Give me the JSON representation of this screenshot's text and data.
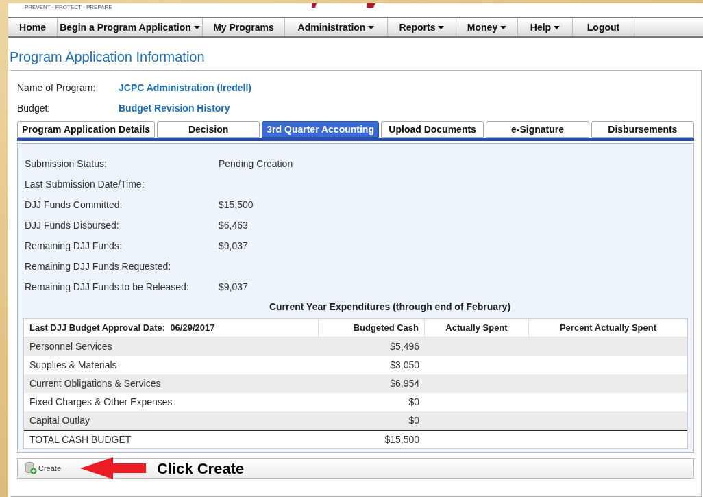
{
  "header": {
    "tagline": "PREVENT · PROTECT · PREPARE"
  },
  "nav": [
    {
      "label": "Home",
      "dropdown": false
    },
    {
      "label": "Begin a Program Application",
      "dropdown": true
    },
    {
      "label": "My Programs",
      "dropdown": false
    },
    {
      "label": "Administration",
      "dropdown": true
    },
    {
      "label": "Reports",
      "dropdown": true
    },
    {
      "label": "Money",
      "dropdown": true
    },
    {
      "label": "Help",
      "dropdown": true
    },
    {
      "label": "Logout",
      "dropdown": false
    }
  ],
  "page_title": "Program Application Information",
  "info": [
    {
      "label": "Name of Program:",
      "value": "JCPC Administration (Iredell)"
    },
    {
      "label": "Budget:",
      "value": "Budget Revision History"
    }
  ],
  "tabs": [
    {
      "label": "Program Application Details",
      "selected": false
    },
    {
      "label": "Decision",
      "selected": false
    },
    {
      "label": "3rd Quarter Accounting",
      "selected": true
    },
    {
      "label": "Upload Documents",
      "selected": false
    },
    {
      "label": "e-Signature",
      "selected": false
    },
    {
      "label": "Disbursements",
      "selected": false
    }
  ],
  "fields": [
    {
      "label": "Submission Status:",
      "value": "Pending Creation"
    },
    {
      "label": "Last Submission Date/Time:"
    },
    {
      "label": "DJJ Funds Committed:",
      "value": "$15,500"
    },
    {
      "label": "DJJ Funds Disbursed:",
      "value": "$6,463"
    },
    {
      "label": "Remaining DJJ Funds:",
      "value": "$9,037"
    },
    {
      "label": "Remaining DJJ Funds Requested:"
    },
    {
      "label": "Remaining DJJ Funds to be Released:",
      "value": "$9,037"
    }
  ],
  "table": {
    "title": "Current Year Expenditures (through end of February)",
    "columns": [
      "Last DJJ Budget Approval Date:  06/29/2017",
      "Budgeted Cash",
      "Actually Spent",
      "Percent Actually Spent"
    ],
    "rows": [
      {
        "category": "Personnel Services",
        "budgeted_cash": "$5,496"
      },
      {
        "category": "Supplies & Materials",
        "budgeted_cash": "$3,050"
      },
      {
        "category": "Current Obligations & Services",
        "budgeted_cash": "$6,954"
      },
      {
        "category": "Fixed Charges & Other Expenses",
        "budgeted_cash": "$0"
      },
      {
        "category": "Capital Outlay",
        "budgeted_cash": "$0"
      }
    ],
    "total": {
      "category": "TOTAL CASH BUDGET",
      "budgeted_cash": "$15,500"
    }
  },
  "create_button": "Create",
  "annotation": "Click Create"
}
